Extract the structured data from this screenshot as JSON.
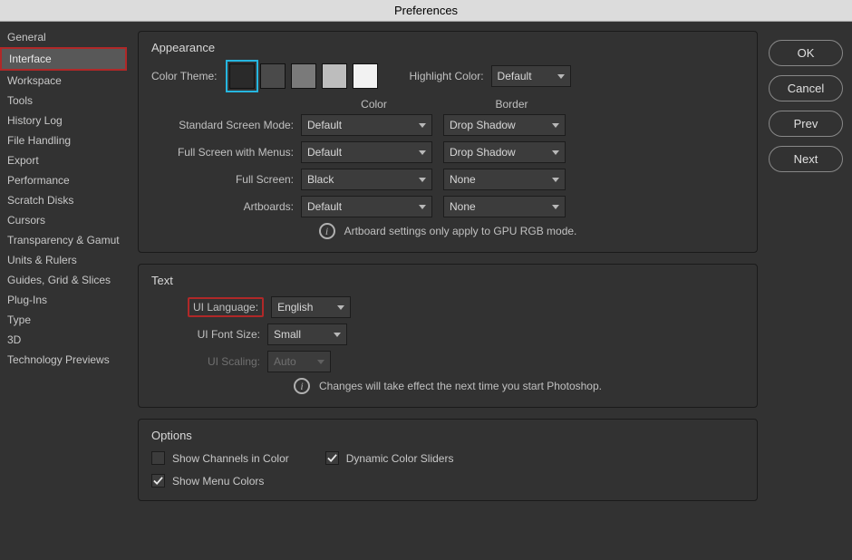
{
  "title": "Preferences",
  "sidebar": {
    "items": [
      {
        "label": "General",
        "selected": false,
        "boxed": false
      },
      {
        "label": "Interface",
        "selected": true,
        "boxed": true
      },
      {
        "label": "Workspace",
        "selected": false,
        "boxed": false
      },
      {
        "label": "Tools",
        "selected": false,
        "boxed": false
      },
      {
        "label": "History Log",
        "selected": false,
        "boxed": false
      },
      {
        "label": "File Handling",
        "selected": false,
        "boxed": false
      },
      {
        "label": "Export",
        "selected": false,
        "boxed": false
      },
      {
        "label": "Performance",
        "selected": false,
        "boxed": false
      },
      {
        "label": "Scratch Disks",
        "selected": false,
        "boxed": false
      },
      {
        "label": "Cursors",
        "selected": false,
        "boxed": false
      },
      {
        "label": "Transparency & Gamut",
        "selected": false,
        "boxed": false
      },
      {
        "label": "Units & Rulers",
        "selected": false,
        "boxed": false
      },
      {
        "label": "Guides, Grid & Slices",
        "selected": false,
        "boxed": false
      },
      {
        "label": "Plug-Ins",
        "selected": false,
        "boxed": false
      },
      {
        "label": "Type",
        "selected": false,
        "boxed": false
      },
      {
        "label": "3D",
        "selected": false,
        "boxed": false
      },
      {
        "label": "Technology Previews",
        "selected": false,
        "boxed": false
      }
    ]
  },
  "actions": {
    "ok": "OK",
    "cancel": "Cancel",
    "prev": "Prev",
    "next": "Next"
  },
  "appearance": {
    "title": "Appearance",
    "color_theme_label": "Color Theme:",
    "swatches": [
      "#2a2a2a",
      "#4a4a4a",
      "#7a7a7a",
      "#bdbdbd",
      "#f2f2f2"
    ],
    "selected_swatch": 0,
    "highlight_color_label": "Highlight Color:",
    "highlight_color_value": "Default",
    "grid_headers": {
      "color": "Color",
      "border": "Border"
    },
    "rows": [
      {
        "label": "Standard Screen Mode:",
        "color": "Default",
        "border": "Drop Shadow"
      },
      {
        "label": "Full Screen with Menus:",
        "color": "Default",
        "border": "Drop Shadow"
      },
      {
        "label": "Full Screen:",
        "color": "Black",
        "border": "None"
      },
      {
        "label": "Artboards:",
        "color": "Default",
        "border": "None"
      }
    ],
    "info_text": "Artboard settings only apply to GPU RGB mode."
  },
  "text": {
    "title": "Text",
    "ui_language_label": "UI Language:",
    "ui_language_value": "English",
    "ui_font_size_label": "UI Font Size:",
    "ui_font_size_value": "Small",
    "ui_scaling_label": "UI Scaling:",
    "ui_scaling_value": "Auto",
    "info_text": "Changes will take effect the next time you start Photoshop."
  },
  "options": {
    "title": "Options",
    "show_channels_label": "Show Channels in Color",
    "show_channels_checked": false,
    "dynamic_sliders_label": "Dynamic Color Sliders",
    "dynamic_sliders_checked": true,
    "show_menu_label": "Show Menu Colors",
    "show_menu_checked": true
  },
  "icon_info_glyph": "i"
}
